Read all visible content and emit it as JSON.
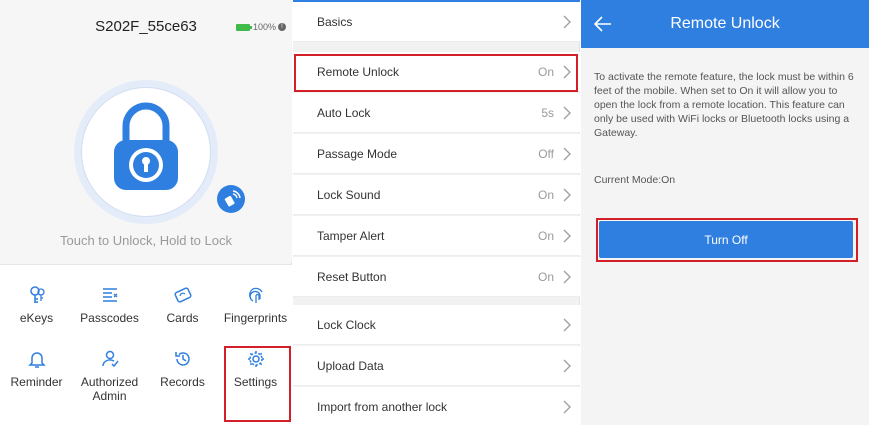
{
  "home": {
    "lock_name": "S202F_55ce63",
    "battery": "100%",
    "touch_text": "Touch to Unlock, Hold to Lock",
    "menu": [
      {
        "label": "eKeys",
        "icon": "ekeys-icon"
      },
      {
        "label": "Passcodes",
        "icon": "passcodes-icon"
      },
      {
        "label": "Cards",
        "icon": "cards-icon"
      },
      {
        "label": "Fingerprints",
        "icon": "fingerprint-icon"
      },
      {
        "label": "Reminder",
        "icon": "bell-icon"
      },
      {
        "label": "Authorized Admin",
        "icon": "admin-icon"
      },
      {
        "label": "Records",
        "icon": "history-icon"
      },
      {
        "label": "Settings",
        "icon": "gear-icon"
      }
    ]
  },
  "settings": {
    "rows": [
      {
        "label": "Basics",
        "value": ""
      },
      {
        "label": "Remote Unlock",
        "value": "On"
      },
      {
        "label": "Auto Lock",
        "value": "5s"
      },
      {
        "label": "Passage Mode",
        "value": "Off"
      },
      {
        "label": "Lock Sound",
        "value": "On"
      },
      {
        "label": "Tamper Alert",
        "value": "On"
      },
      {
        "label": "Reset Button",
        "value": "On"
      },
      {
        "label": "Lock Clock",
        "value": ""
      },
      {
        "label": "Upload Data",
        "value": ""
      },
      {
        "label": "Import from another lock",
        "value": ""
      }
    ]
  },
  "remote": {
    "title": "Remote Unlock",
    "description": "To activate the remote feature, the lock must be within 6 feet of the mobile. When set to On it will allow you to open the lock from a remote location. This feature can only be used with WiFi locks or Bluetooth locks using a Gateway.",
    "current_mode": "Current Mode:On",
    "button": "Turn Off"
  },
  "colors": {
    "accent": "#2f7fe0",
    "highlight": "#d32028",
    "battery": "#3fba4b"
  }
}
